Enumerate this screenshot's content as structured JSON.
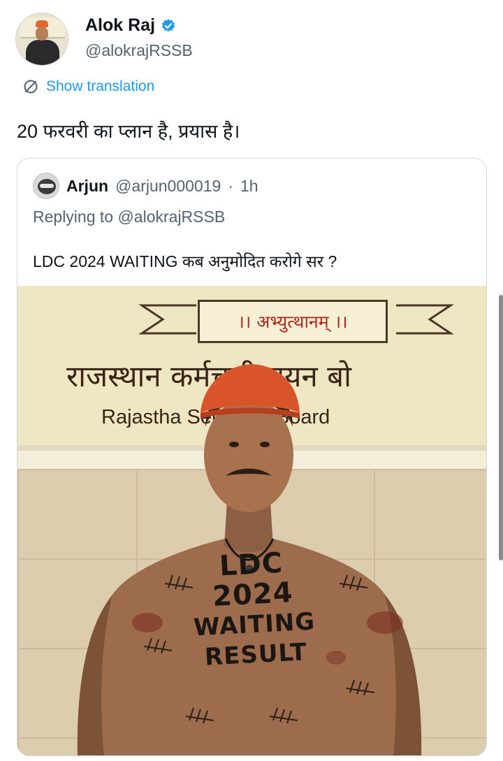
{
  "tweet": {
    "display_name": "Alok Raj",
    "handle": "@alokrajRSSB",
    "show_translation": "Show translation",
    "text": "20 फरवरी का प्लान है, प्रयास है।"
  },
  "quote": {
    "display_name": "Arjun",
    "handle": "@arjun000019",
    "separator": "·",
    "time": "1h",
    "replying": "Replying to @alokrajRSSB",
    "text": "LDC 2024 WAITING कब अनुमोदित करोगे सर ?"
  },
  "photo": {
    "motto": "।। अभ्युत्थानम् ।।",
    "hindi_board": "राजस्थान कर्मचारी चयन बो",
    "english_board": "Rajastha Selection Board",
    "body_text": [
      "LDC",
      "2024",
      "WAITING",
      "RESULT"
    ]
  },
  "colors": {
    "accent": "#1d9bf0",
    "secondary_text": "#536471",
    "border": "#cfd9de"
  },
  "icons": {
    "verified": "verified-badge-icon",
    "translate": "translate-icon"
  }
}
